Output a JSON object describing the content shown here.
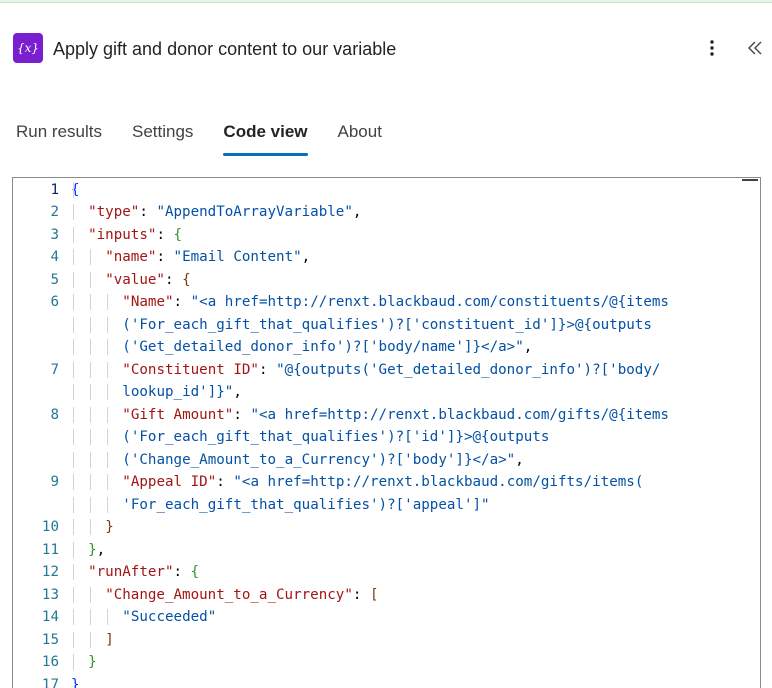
{
  "header": {
    "icon_label": "{x}",
    "title": "Apply gift and donor content to our variable",
    "more_icon": "more-vertical-icon",
    "collapse_icon": "double-chevron-left-icon"
  },
  "tabs": [
    {
      "label": "Run results",
      "active": false
    },
    {
      "label": "Settings",
      "active": false
    },
    {
      "label": "Code view",
      "active": true
    },
    {
      "label": "About",
      "active": false
    }
  ],
  "colors": {
    "action_icon": "#7a1fd0",
    "tab_underline": "#0f6cbd",
    "json_key": "#a31515",
    "json_string": "#0451a5",
    "line_number": "#237893"
  },
  "code": {
    "line_numbers": [
      "1",
      "2",
      "3",
      "4",
      "5",
      "6",
      "",
      "",
      "7",
      "",
      "8",
      "",
      "",
      "9",
      "",
      "10",
      "11",
      "12",
      "13",
      "14",
      "15",
      "16",
      "17"
    ],
    "rows": [
      [
        "{"
      ],
      [
        "\"type\"",
        ": ",
        "\"AppendToArrayVariable\"",
        ","
      ],
      [
        "\"inputs\"",
        ": ",
        "{"
      ],
      [
        "\"name\"",
        ": ",
        "\"Email Content\"",
        ","
      ],
      [
        "\"value\"",
        ": ",
        "{"
      ],
      [
        "\"Name\"",
        ": ",
        "\"<a href=http://renxt.blackbaud.com/constituents/@{items"
      ],
      [
        "('For_each_gift_that_qualifies')?['constituent_id']}>@{outputs"
      ],
      [
        "('Get_detailed_donor_info')?['body/name']}</a>\"",
        ","
      ],
      [
        "\"Constituent ID\"",
        ": ",
        "\"@{outputs('Get_detailed_donor_info')?['body/"
      ],
      [
        "lookup_id']}\"",
        ","
      ],
      [
        "\"Gift Amount\"",
        ": ",
        "\"<a href=http://renxt.blackbaud.com/gifts/@{items"
      ],
      [
        "('For_each_gift_that_qualifies')?['id']}>@{outputs"
      ],
      [
        "('Change_Amount_to_a_Currency')?['body']}</a>\"",
        ","
      ],
      [
        "\"Appeal ID\"",
        ": ",
        "\"<a href=http://renxt.blackbaud.com/gifts/items("
      ],
      [
        "'For_each_gift_that_qualifies')?['appeal']\""
      ],
      [
        "}"
      ],
      [
        "}",
        ","
      ],
      [
        "\"runAfter\"",
        ": ",
        "{"
      ],
      [
        "\"Change_Amount_to_a_Currency\"",
        ": ",
        "["
      ],
      [
        "\"Succeeded\""
      ],
      [
        "]"
      ],
      [
        "}"
      ],
      [
        "}"
      ]
    ]
  }
}
